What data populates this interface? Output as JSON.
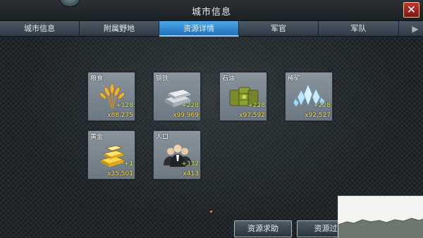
{
  "window": {
    "title": "城市信息",
    "close_label": "✕"
  },
  "tabs": [
    {
      "label": "城市信息",
      "active": false
    },
    {
      "label": "附属野地",
      "active": false
    },
    {
      "label": "资源详情",
      "active": true
    },
    {
      "label": "军官",
      "active": false
    },
    {
      "label": "军队",
      "active": false
    }
  ],
  "tab_scroll_icon": "▶",
  "resources": [
    {
      "name": "粮食",
      "gain": "+128",
      "amount": "x88,275",
      "icon": "wheat-icon"
    },
    {
      "name": "钢铁",
      "gain": "+228",
      "amount": "x99,969",
      "icon": "steel-ingot-icon"
    },
    {
      "name": "石油",
      "gain": "+228",
      "amount": "x97,592",
      "icon": "oil-barrel-icon"
    },
    {
      "name": "稀矿",
      "gain": "+228",
      "amount": "x92,527",
      "icon": "crystal-icon"
    },
    {
      "name": "黄金",
      "gain": "+1",
      "amount": "x35,501",
      "icon": "gold-bars-icon"
    },
    {
      "name": "人口",
      "gain": "+332",
      "amount": "x413",
      "icon": "population-icon"
    }
  ],
  "buttons": {
    "request": "资源求助",
    "transfer": "资源过"
  },
  "colors": {
    "active_tab": "#2a8ad8",
    "gain_text": "#d7f05a",
    "amount_text": "#ffe04a",
    "close_button": "#b5261f"
  }
}
